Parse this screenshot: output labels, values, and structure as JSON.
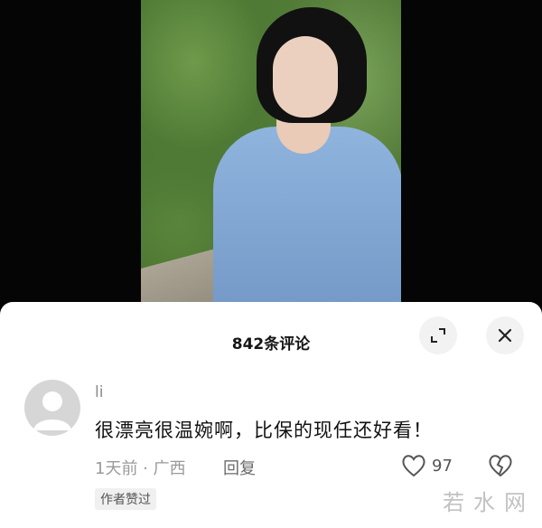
{
  "comments_panel": {
    "title": "842条评论"
  },
  "comment": {
    "author": "li",
    "text": "很漂亮很温婉啊，比保的现任还好看！",
    "meta": "1天前 · 广西",
    "reply_label": "回复",
    "like_count": "97",
    "badge": "作者赞过"
  },
  "watermark": "若水网",
  "icons": {
    "expand": "expand-icon",
    "close": "close-icon",
    "like": "heart-outline-icon",
    "dislike": "broken-heart-icon",
    "avatar": "default-user-avatar"
  },
  "colors": {
    "panel_bg": "#ffffff",
    "button_bg": "#f2f2f2",
    "sweater": "#8fb4dd"
  }
}
